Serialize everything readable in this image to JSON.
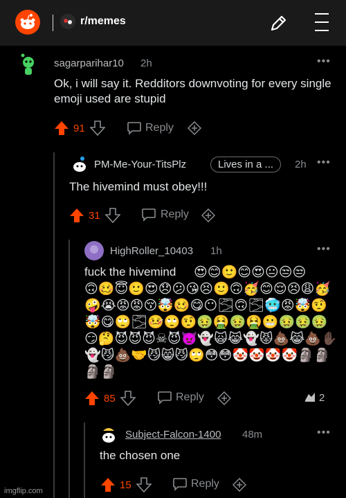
{
  "header": {
    "subreddit": "r/memes",
    "logo_icon": "reddit-logo-icon",
    "edit_icon": "pencil-icon",
    "menu_icon": "hamburger-menu-icon",
    "brand_color": "#ff4500"
  },
  "comments": [
    {
      "username": "sagarparihar10",
      "time": "2h",
      "text": "Ok, i will say it. Redditors downvoting for every single emoji used are stupid",
      "score": "91",
      "reply_label": "Reply"
    },
    {
      "username": "PM-Me-Your-TitsPlz",
      "flair": "Lives in a ...",
      "time": "2h",
      "text": "The hivemind must obey!!!",
      "score": "31",
      "reply_label": "Reply"
    },
    {
      "username": "HighRoller_10403",
      "time": "1h",
      "text": "fuck the hivemind",
      "emojis": "😍😊🙂😊😍😐😒😒🙃🥴😇🙂😍😞😕😘😣🙂🙃🥳😊😌😣😩🥳🤪😭😡😡😚🤯🥴😋😶🌫🙃🌫🥶😡🤯🤨🤯😋🙄🌫🤒🙄🤨🤢🤮🤢🤮😬🤢🤢🤢😏🤔😈😈😈☠😈👿👻🙀😹👻😾💩😹💩✋🏿👻😼💩🤝😼😸😼🙄😳😳🤡🤡🤡🤡🗿🗿🗿🗿",
      "score": "85",
      "reply_label": "Reply",
      "award_count": "2"
    },
    {
      "username": "Subject-Falcon-1400",
      "time": "48m",
      "text": "the chosen one",
      "score": "15",
      "reply_label": "Reply"
    }
  ],
  "watermark": "imgflip.com"
}
